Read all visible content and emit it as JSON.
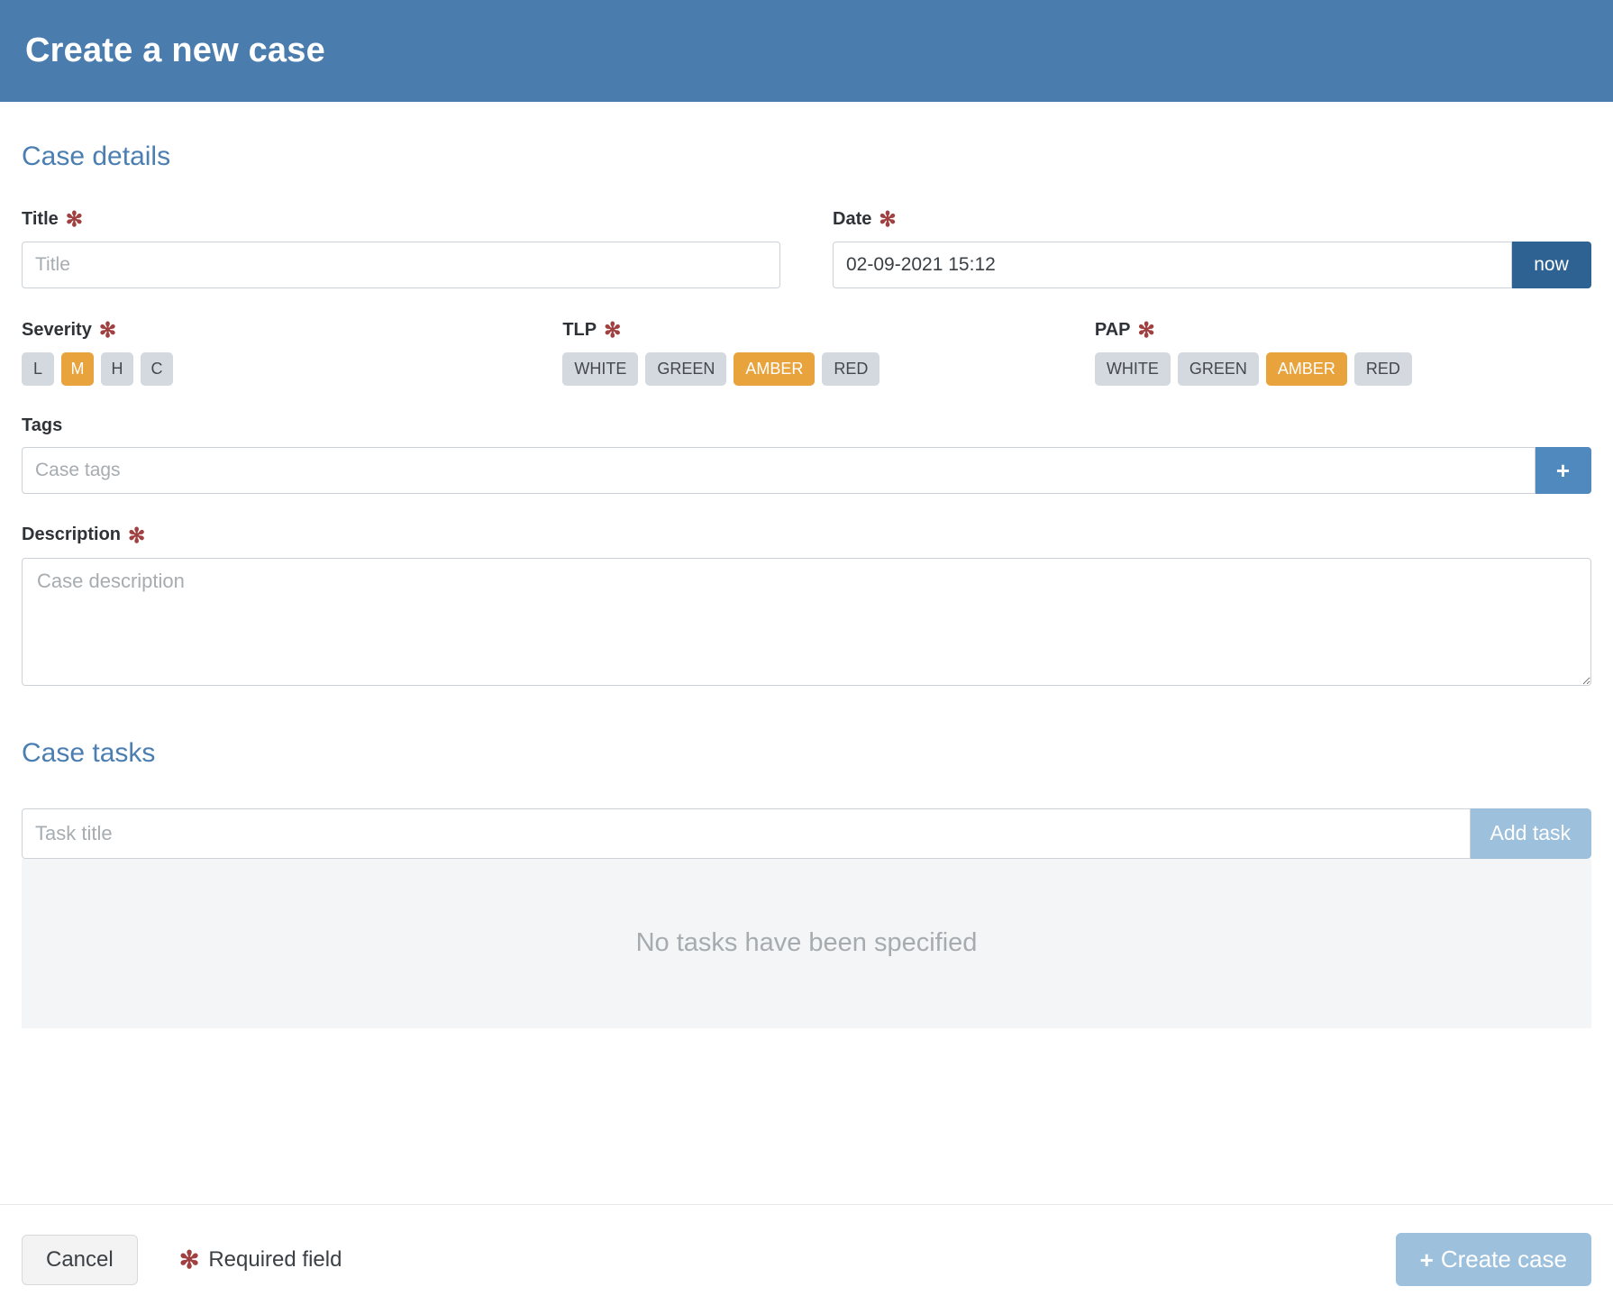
{
  "header": {
    "title": "Create a new case"
  },
  "sections": {
    "details_heading": "Case details",
    "tasks_heading": "Case tasks"
  },
  "fields": {
    "title": {
      "label": "Title",
      "required_marker": "✻",
      "placeholder": "Title",
      "value": ""
    },
    "date": {
      "label": "Date",
      "required_marker": "✻",
      "value": "02-09-2021 15:12",
      "now_button": "now"
    },
    "severity": {
      "label": "Severity",
      "required_marker": "✻",
      "options": [
        "L",
        "M",
        "H",
        "C"
      ],
      "selected": "M"
    },
    "tlp": {
      "label": "TLP",
      "required_marker": "✻",
      "options": [
        "WHITE",
        "GREEN",
        "AMBER",
        "RED"
      ],
      "selected": "AMBER"
    },
    "pap": {
      "label": "PAP",
      "required_marker": "✻",
      "options": [
        "WHITE",
        "GREEN",
        "AMBER",
        "RED"
      ],
      "selected": "AMBER"
    },
    "tags": {
      "label": "Tags",
      "placeholder": "Case tags",
      "value": "",
      "add_button_icon": "plus-icon",
      "add_button_label": "+"
    },
    "description": {
      "label": "Description",
      "required_marker": "✻",
      "placeholder": "Case description",
      "value": ""
    }
  },
  "tasks": {
    "input_placeholder": "Task title",
    "input_value": "",
    "add_button": "Add task",
    "empty_message": "No tasks have been specified"
  },
  "footer": {
    "cancel": "Cancel",
    "required_marker": "✻",
    "required_note": "Required field",
    "create_icon": "+",
    "create": "Create case"
  },
  "colors": {
    "header_blue": "#4a7cad",
    "section_heading_blue": "#4b7eb1",
    "required_red": "#a04040",
    "selected_amber": "#e8a33d",
    "pill_gray": "#d3d9df",
    "now_button_blue": "#2e6292",
    "plus_button_blue": "#5089bd",
    "muted_blue": "#9dc0dc",
    "empty_bg": "#f4f5f6"
  }
}
